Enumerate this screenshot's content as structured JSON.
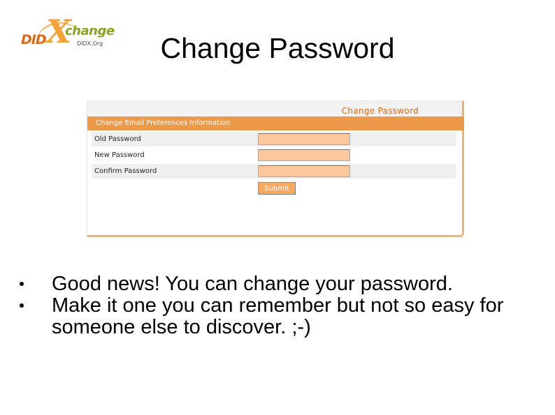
{
  "logo": {
    "didx": "DID",
    "x": "X",
    "change": "change",
    "org": "DIDX.Org"
  },
  "slide": {
    "title": "Change Password"
  },
  "panel": {
    "heading": "Change Password",
    "section": "Change Email Preferences Information",
    "fields": [
      {
        "label": "Old Password",
        "value": ""
      },
      {
        "label": "New Password",
        "value": ""
      },
      {
        "label": "Confirm Password",
        "value": ""
      }
    ],
    "submit": "Submit",
    "colors": {
      "accent": "#ec9a4a",
      "field": "#fcc79c",
      "heading": "#d2691e"
    }
  },
  "bullets": [
    "Good news! You can change your password.",
    "Make it one you can remember but not so easy for someone else to discover. ;-)"
  ]
}
